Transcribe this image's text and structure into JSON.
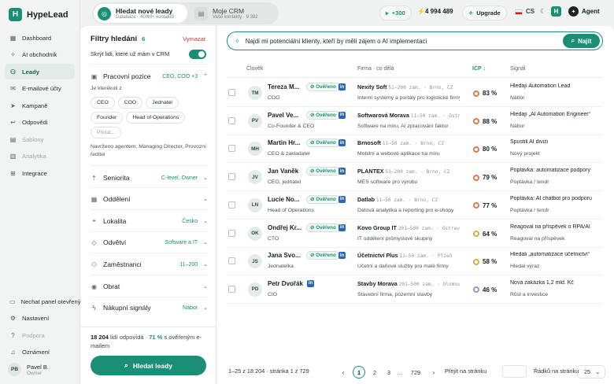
{
  "app": {
    "name": "HypeLead",
    "logo_letter": "H"
  },
  "sidebar": {
    "items": [
      {
        "label": "Dashboard",
        "icon": "grid-icon",
        "active": false
      },
      {
        "label": "AI obchodník",
        "icon": "sparkle-icon",
        "active": false
      },
      {
        "label": "Leady",
        "icon": "people-icon",
        "active": true
      },
      {
        "label": "E-mailové účty",
        "icon": "mail-icon",
        "active": false
      },
      {
        "label": "Kampaně",
        "icon": "send-icon",
        "active": false
      },
      {
        "label": "Odpovědi",
        "icon": "reply-icon",
        "active": false
      },
      {
        "label": "Šablony",
        "icon": "template-icon",
        "active": false,
        "muted": true
      },
      {
        "label": "Analytika",
        "icon": "chart-icon",
        "active": false,
        "muted": true
      },
      {
        "label": "Integrace",
        "icon": "apps-icon",
        "active": false
      }
    ],
    "bottom_items": [
      {
        "label": "Nechat panel otevřený",
        "icon": "panel-icon"
      },
      {
        "label": "Nastavení",
        "icon": "gear-icon"
      },
      {
        "label": "Podpora",
        "icon": "help-icon",
        "muted": true
      },
      {
        "label": "Oznámení",
        "icon": "bell-icon"
      }
    ],
    "user": {
      "initials": "PB",
      "name": "Pavel B.",
      "role": "Owner"
    }
  },
  "topbar": {
    "tab_search": {
      "title": "Hledat nové leady",
      "subtitle": "Databáze · 400M+ kontaktů"
    },
    "tab_crm": {
      "title": "Moje CRM",
      "subtitle": "Vaše kontakty · 9 392"
    },
    "credits_add": "+300",
    "credits": "4 994 489",
    "upgrade": "Upgrade",
    "language": "CS",
    "agent": "Agent"
  },
  "filters": {
    "title": "Filtry hledání",
    "count": "6",
    "clear": "Vymazat",
    "hide_in_crm": "Skrýt lidi, které už mám v CRM",
    "position": {
      "label": "Pracovní pozice",
      "value": "CEO, COO +3"
    },
    "any_of": "Je kterékoli z",
    "chips": [
      "CEO",
      "COO",
      "Jednatel",
      "Founder",
      "Head of Operations"
    ],
    "add_placeholder": "Přidat...",
    "suggested": "Navrženo agentem: Managing Director, Provozní ředitel",
    "seniority": {
      "label": "Seniorita",
      "value": "C-level, Owner"
    },
    "department": {
      "label": "Oddělení",
      "value": ""
    },
    "location": {
      "label": "Lokalita",
      "value": "Česko"
    },
    "industry": {
      "label": "Odvětví",
      "value": "Software a IT"
    },
    "employees": {
      "label": "Zaměstnanci",
      "value": "11–200"
    },
    "revenue": {
      "label": "Obrat",
      "value": ""
    },
    "buying_signals": {
      "label": "Nákupní signály",
      "value": "Nábor"
    },
    "result_count": "18 204",
    "result_text": "lidí odpovídá ·",
    "result_pct": "71 %",
    "result_suffix": "s ověřeným e-mailem",
    "search_button": "Hledat leady"
  },
  "search": {
    "value": "Najdi mi potenciální klienty, kteří by měli zájem o AI implementaci",
    "button": "Najít"
  },
  "table": {
    "columns": [
      "Člověk",
      "Firma · co dělá",
      "ICP",
      "Signál"
    ],
    "verified_label": "Ověřeno",
    "rows": [
      {
        "initials": "TM",
        "name": "Tereza M...",
        "title": "COO",
        "verified": true,
        "company": "Nexity Soft",
        "company_meta": "51–200 zam. · Brno, CZ",
        "desc": "Interní systémy a portály pro logistické firmy",
        "icp": "83 %",
        "icp_level": "high",
        "signal": "Hledají Automation Lead",
        "signal_type": "Nábor"
      },
      {
        "initials": "PV",
        "name": "Pavel Ve...",
        "title": "Co-Founder & CEO",
        "verified": true,
        "company": "Softwarová Morava",
        "company_meta": "11–50 zam. · Ostrava",
        "desc": "Software na míru, AI zpracování faktur",
        "icp": "88 %",
        "icp_level": "high",
        "signal": "Hledají „AI Automation Engineer“",
        "signal_type": "Nábor"
      },
      {
        "initials": "MH",
        "name": "Martin Hr...",
        "title": "CEO & zakladatel",
        "verified": true,
        "company": "Brnosoft",
        "company_meta": "11–50 zam. · Brno, CZ",
        "desc": "Mobilní a webové aplikace na míru",
        "icp": "80 %",
        "icp_level": "high",
        "signal": "Spustili AI divizi",
        "signal_type": "Nový projekt"
      },
      {
        "initials": "JV",
        "name": "Jan Vaněk",
        "title": "CEO, jednatel",
        "verified": true,
        "company": "PLANTEX",
        "company_meta": "51–200 zam. · Brno, CZ",
        "desc": "MES software pro výrobu",
        "icp": "79 %",
        "icp_level": "high",
        "signal": "Poptávka: automatizace podpory",
        "signal_type": "Poptávka / tendr"
      },
      {
        "initials": "LN",
        "name": "Lucie No...",
        "title": "Head of Operations",
        "verified": true,
        "company": "Datlab",
        "company_meta": "11–50 zam. · Brno, CZ",
        "desc": "Datová analytika a reporting pro e-shopy",
        "icp": "77 %",
        "icp_level": "high",
        "signal": "Poptávka: AI chatbot pro podporu",
        "signal_type": "Poptávka / tendr"
      },
      {
        "initials": "OK",
        "name": "Ondřej Kr...",
        "title": "CTO",
        "verified": true,
        "company": "Kovo Group IT",
        "company_meta": "201–500 zam. · Ostrava",
        "desc": "IT oddělení průmyslové skupiny",
        "icp": "64 %",
        "icp_level": "mid",
        "signal": "Reagoval na příspěvek o RPA/AI",
        "signal_type": "Reagoval na příspěvek"
      },
      {
        "initials": "JS",
        "name": "Jana Svo...",
        "title": "Jednatelka",
        "verified": true,
        "company": "Účetnictví Plus",
        "company_meta": "11–50 zam. · Plzeň",
        "desc": "Účetní a daňové služby pro malé firmy",
        "icp": "58 %",
        "icp_level": "mid",
        "signal": "Hledali „automatizace účetnictví“",
        "signal_type": "Hledal výraz"
      },
      {
        "initials": "PD",
        "name": "Petr Dvořák",
        "title": "CIO",
        "verified": false,
        "company": "Stavby Morava",
        "company_meta": "201–500 zam. · Olomouc",
        "desc": "Stavební firma, pozemní stavby",
        "icp": "46 %",
        "icp_level": "low",
        "signal": "Nová zakázka 1,2 mld. Kč",
        "signal_type": "Růst a investice"
      }
    ]
  },
  "pagination": {
    "range": "1–25 z 18 204 · stránka 1 z 729",
    "pages": [
      "1",
      "2",
      "3",
      "…",
      "729"
    ],
    "jump_label": "Přejít na stránku",
    "per_page_label": "Řádků na stránku",
    "per_page": "25"
  },
  "colors": {
    "accent": "#1a8f76",
    "danger": "#c23a2e",
    "linkedin": "#2a66b8"
  }
}
